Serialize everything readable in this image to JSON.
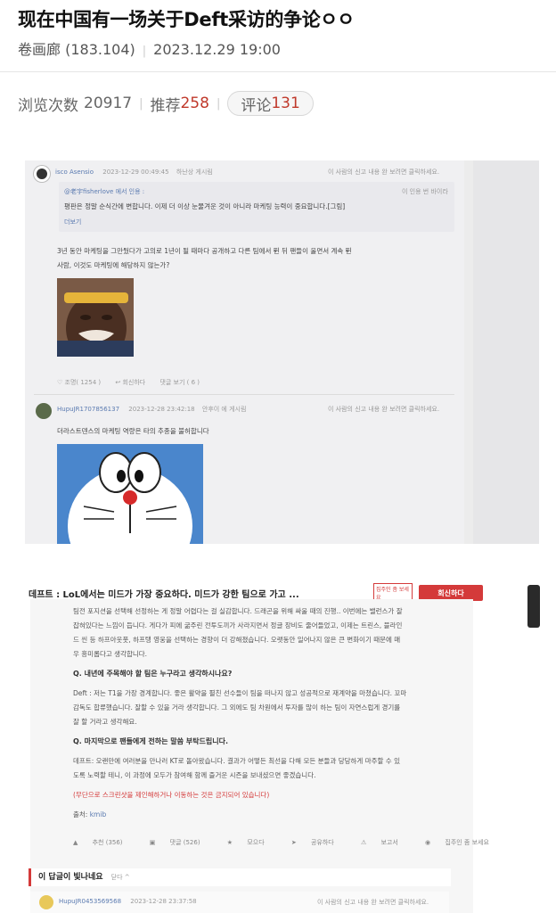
{
  "article": {
    "title": "现在中国有一场关于Deft采访的争论ㅇㅇ",
    "author": "卷画廊 (183.104)",
    "datetime": "2023.12.29 19:00"
  },
  "stats": {
    "views_label": "浏览次数",
    "views_value": "20917",
    "recommend_label": "推荐",
    "recommend_value": "258",
    "comments_label": "评论",
    "comments_value": "131"
  },
  "shot1": {
    "post1": {
      "user": "isco Asensio",
      "time": "2023-12-29 00:49:45",
      "tags": "하난상  게시림",
      "right_meta": "이 사람의 신고 내용   완 보려면   클릭하세요.",
      "quote_header": "@老宇fisherlove 에서 인용 :",
      "quote_right": "이 인용 번 바이라",
      "quote_text": "평판은 정말 순식간에 변합니다. 이제 더 이상 눈물겨운 것이 아니라 마케팅 능력이 중요합니다.[그림]",
      "quote_more": "더보기",
      "text_line1": "3년 동안 마케팅을 그만뒀다가 고의로 1년이 될 때마다 공개하고 다른 팀에서 뛴 뒤 팬들이 울면서 계속 뛴",
      "text_line2": "사람, 이것도 마케팅에 해당하지 않는가?",
      "like": "조명( 1254 )",
      "reply": "회신하다",
      "view_replies": "댓글 보기 ( 6 )"
    },
    "post2": {
      "user": "HupuJR1707856137",
      "time": "2023-12-28 23:42:18",
      "tags": "안후이  에 게시림",
      "right_meta": "이 사람의 신고 내용   완 보려면   클릭하세요.",
      "text": "더라스트덴스의 마케팅 역량은 타의 추종을 불허합니다"
    }
  },
  "shot2": {
    "header": "데프트 : LoL에서는 미드가 가장 중요하다. 미드가 강한 팀으로 가고 ...",
    "report_box": "집주인 좀 보세요",
    "subscribe": "회신하다",
    "p1a": "팀전 포지션을 선택해 선정하는 게 정말 어렵다는 걸 실감합니다. 드래곤을 위해 싸울 때의 진행.. 이번에는 밸런스가 잘",
    "p1b": "잡혀있다는 느낌이 듭니다. 게다가 피에 굶주린 전투도끼가 사라지면서 정글 장비도 줄어들었고, 이제는 트린스, 블라인",
    "p1c": "드 씬 등 하프아웃풋, 하프탱 영웅을 선택하는 경향이 더 강해졌습니다. 오랫동안 일어나지 않은 큰 변화이기 때문에 매",
    "p1d": "우 흥미롭다고 생각합니다.",
    "q1": "Q. 내년에 주목해야 할 팀은 누구라고 생각하시나요?",
    "a1a": "Deft : 저는 T1을 가장 경계합니다. 좋은 활약을 펼친 선수들이 팀을 떠나지 않고 성공적으로 재계약을 마쳤습니다. 꼬마",
    "a1b": "감독도 합류했습니다. 잘할 수 있을 거라 생각합니다. 그 외에도 팀 차원에서 투자를 많이 하는 팀이 자연스럽게 경기를",
    "a1c": "잘 할 거라고 생각해요.",
    "q2": "Q. 마지막으로 팬들에게 전하는 말씀 부탁드립니다.",
    "a2a": "데프트: 오랜만에 여러분을 만나러 KT로 돌아왔습니다. 결과가 어떻든 최선을 다해 모든 분들과 당당하게 마주할 수 있",
    "a2b": "도록 노력할 테니, 이 과정에 모두가 참여해 함께 즐거운 시즌을 보내셨으면 좋겠습니다.",
    "warning": "(무단으로 스크린샷을 제인해하거나 이동하는 것은 금지되어 있습니다)",
    "source_label": "출처:",
    "source_value": "kmib",
    "actions": [
      "추천 (356)",
      "댓글 (526)",
      "모으다",
      "공유하다",
      "보고서",
      "집주인 좀 보세요"
    ],
    "reply_header": "이 답글이 빛나네요",
    "reply_header_sub": "닫다 ^",
    "reply_user": "HupuJR0453569568",
    "reply_time": "2023-12-28 23:37:58",
    "reply_right": "이 사람의 신고 내용   완 보려면   클릭하세요."
  }
}
